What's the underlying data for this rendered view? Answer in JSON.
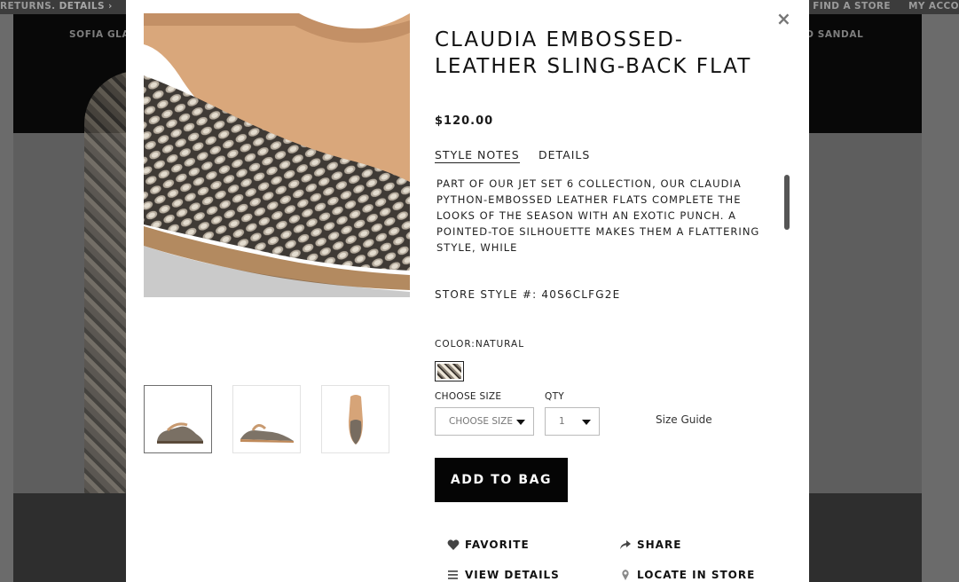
{
  "background": {
    "topbar_left": "RETURNS.",
    "topbar_details": "DETAILS ›",
    "topbar_find_store": "FIND A STORE",
    "topbar_account": "MY ACCO",
    "nav_item_left": "SOFIA GLA",
    "nav_item_right": "RID SANDAL"
  },
  "modal": {
    "close_label": "×",
    "title": "CLAUDIA EMBOSSED-LEATHER SLING-BACK FLAT",
    "price": "$120.00",
    "tabs": [
      {
        "label": "STYLE NOTES",
        "active": true
      },
      {
        "label": "DETAILS",
        "active": false
      }
    ],
    "description": "PART OF OUR JET SET 6 COLLECTION, OUR CLAUDIA PYTHON-EMBOSSED LEATHER FLATS COMPLETE THE LOOKS OF THE SEASON WITH AN EXOTIC PUNCH. A POINTED-TOE SILHOUETTE MAKES THEM A FLATTERING STYLE, WHILE",
    "store_style": "STORE STYLE #: 40S6CLFG2E",
    "color_label": "COLOR:NATURAL",
    "size_label": "CHOOSE SIZE",
    "size_value": "CHOOSE SIZE",
    "qty_label": "QTY",
    "qty_value": "1",
    "size_guide": "Size Guide",
    "add_to_bag": "ADD TO BAG",
    "actions": {
      "favorite": "FAVORITE",
      "share": "SHARE",
      "view_details": "VIEW DETAILS",
      "locate_in_store": "LOCATE IN STORE"
    },
    "icons": [
      "close-icon",
      "heart-icon",
      "share-arrow-icon",
      "list-icon",
      "map-pin-icon",
      "caret-down-icon"
    ],
    "colors": {
      "button": "#050505",
      "text": "#1a1a1a",
      "scrollbar": "#555555"
    }
  }
}
